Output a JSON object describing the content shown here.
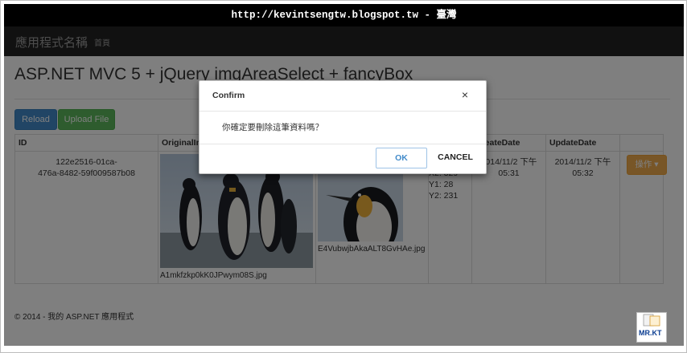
{
  "url_bar": "http://kevintsengtw.blogspot.tw - 臺灣",
  "navbar": {
    "brand": "應用程式名稱",
    "home": "首頁"
  },
  "page_title": "ASP.NET MVC 5 + jQuery imgAreaSelect + fancyBox",
  "buttons": {
    "reload": "Reload",
    "upload": "Upload File"
  },
  "table": {
    "headers": [
      "ID",
      "OriginalImage",
      "",
      "",
      "CreateDate",
      "UpdateDate",
      ""
    ],
    "row": {
      "id_line1": "122e2516-01ca-",
      "id_line2": "476a-8482-59f009587b08",
      "original_file": "A1mkfzkp0kK0JPwym08S.jpg",
      "crop_file": "E4VubwjbAkaALT8GvHAe.jpg",
      "coords": [
        "X2: 329",
        "Y1: 28",
        "Y2: 231"
      ],
      "create_line1": "2014/11/2 下午",
      "create_line2": "05:31",
      "update_line1": "2014/11/2 下午",
      "update_line2": "05:32",
      "action": "操作 ▾"
    }
  },
  "footer": "© 2014 - 我的 ASP.NET 應用程式",
  "modal": {
    "title": "Confirm",
    "close": "×",
    "message": "你確定要刪除這筆資料嗎？",
    "ok": "OK",
    "cancel": "CANCEL"
  },
  "watermark": {
    "text": "MR.KT"
  },
  "colors": {
    "primary": "#428bca",
    "success": "#5cb85c",
    "warning": "#f0ad4e",
    "navbar": "#222222"
  }
}
